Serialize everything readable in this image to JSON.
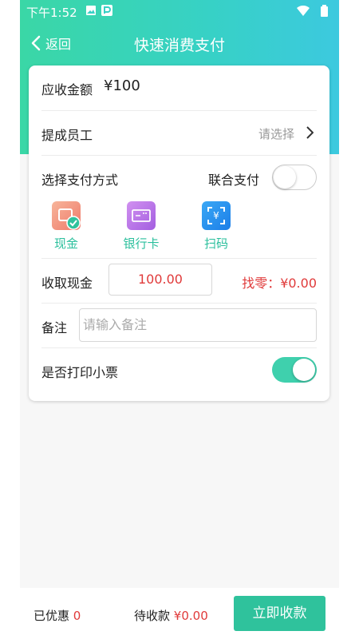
{
  "status_bar": {
    "time": "下午1:52",
    "left_icons": [
      "image-icon",
      "parking-icon"
    ],
    "right_icons": [
      "wifi-icon",
      "battery-icon"
    ]
  },
  "nav": {
    "back_label": "返回",
    "title": "快速消费支付"
  },
  "amount": {
    "label": "应收金额",
    "value": "¥100"
  },
  "staff": {
    "label": "提成员工",
    "placeholder": "请选择"
  },
  "payment": {
    "label": "选择支付方式",
    "combined_label": "联合支付",
    "combined_on": false,
    "methods": [
      {
        "label": "现金",
        "icon": "cash-icon",
        "selected": true
      },
      {
        "label": "银行卡",
        "icon": "bank-card-icon",
        "selected": false
      },
      {
        "label": "扫码",
        "icon": "scan-icon",
        "selected": false
      }
    ]
  },
  "cash": {
    "label": "收取现金",
    "value": "100.00",
    "change": "找零：¥0.00"
  },
  "remark": {
    "label": "备注",
    "placeholder": "请输入备注"
  },
  "print": {
    "label": "是否打印小票",
    "on": true
  },
  "bottom": {
    "discount_label": "已优惠",
    "discount_value": "0",
    "pending_label": "待收款",
    "pending_value": "¥0.00",
    "collect_label": "立即收款"
  },
  "colors": {
    "accent": "#2fc29c",
    "header_start": "#3ad7a6",
    "header_end": "#3cc9df",
    "error": "#e03a3a"
  }
}
